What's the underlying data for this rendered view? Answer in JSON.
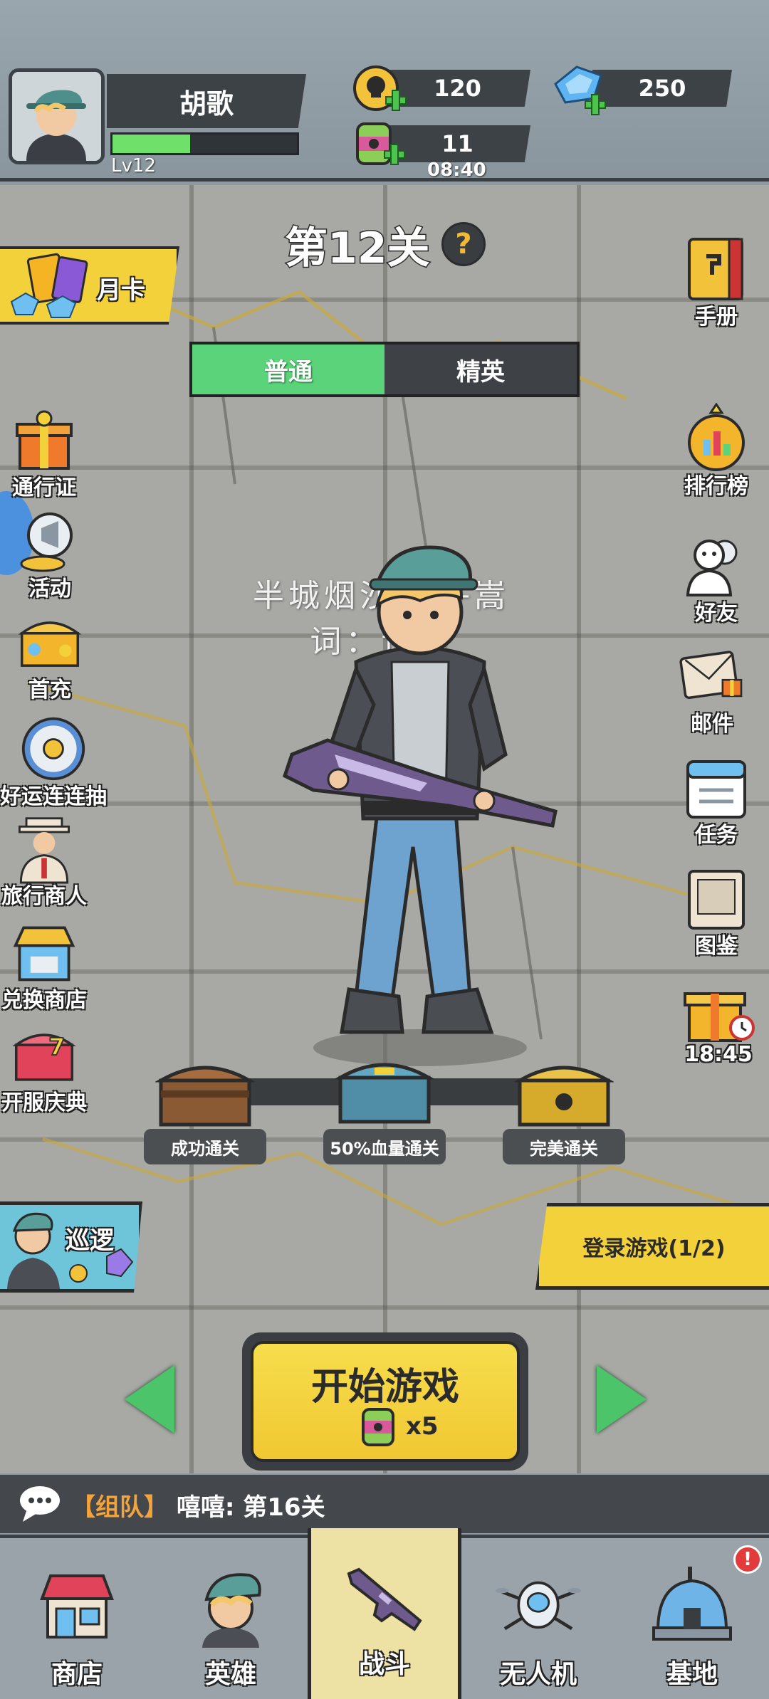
{
  "player": {
    "name": "胡歌",
    "level": "Lv12",
    "xp_fraction": 0.42
  },
  "resources": {
    "gold": "120",
    "gems": "250",
    "energy": "11",
    "energy_timer": "08:40"
  },
  "stage": {
    "title": "第12关",
    "help": "?",
    "modes": [
      "普通",
      "精英"
    ],
    "active_mode": "普通"
  },
  "left_menu": {
    "month_card": "月卡",
    "items": [
      "通行证",
      "活动",
      "首充",
      "好运连连抽",
      "旅行商人",
      "兑换商店",
      "开服庆典"
    ]
  },
  "right_menu": {
    "items": [
      "手册",
      "排行榜",
      "好友",
      "邮件",
      "任务",
      "图鉴"
    ],
    "gift_timer": "18:45"
  },
  "lyrics": {
    "line1": "半城烟沙 - 许嵩",
    "line2": "词：许嵩"
  },
  "chests": [
    "成功通关",
    "50%血量通关",
    "完美通关"
  ],
  "patrol": "巡逻",
  "login_banner": "登录游戏(1/2)",
  "start": {
    "label": "开始游戏",
    "cost": "x5"
  },
  "chat": {
    "tag": "【组队】",
    "message": "嘻嘻: 第16关"
  },
  "bottom_nav": {
    "items": [
      "商店",
      "英雄",
      "战斗",
      "无人机",
      "基地"
    ],
    "active": "战斗",
    "badge": "!"
  },
  "colors": {
    "accent_green": "#5ad37a",
    "accent_yellow": "#f3d13a",
    "dark_plate": "#3d4247"
  }
}
